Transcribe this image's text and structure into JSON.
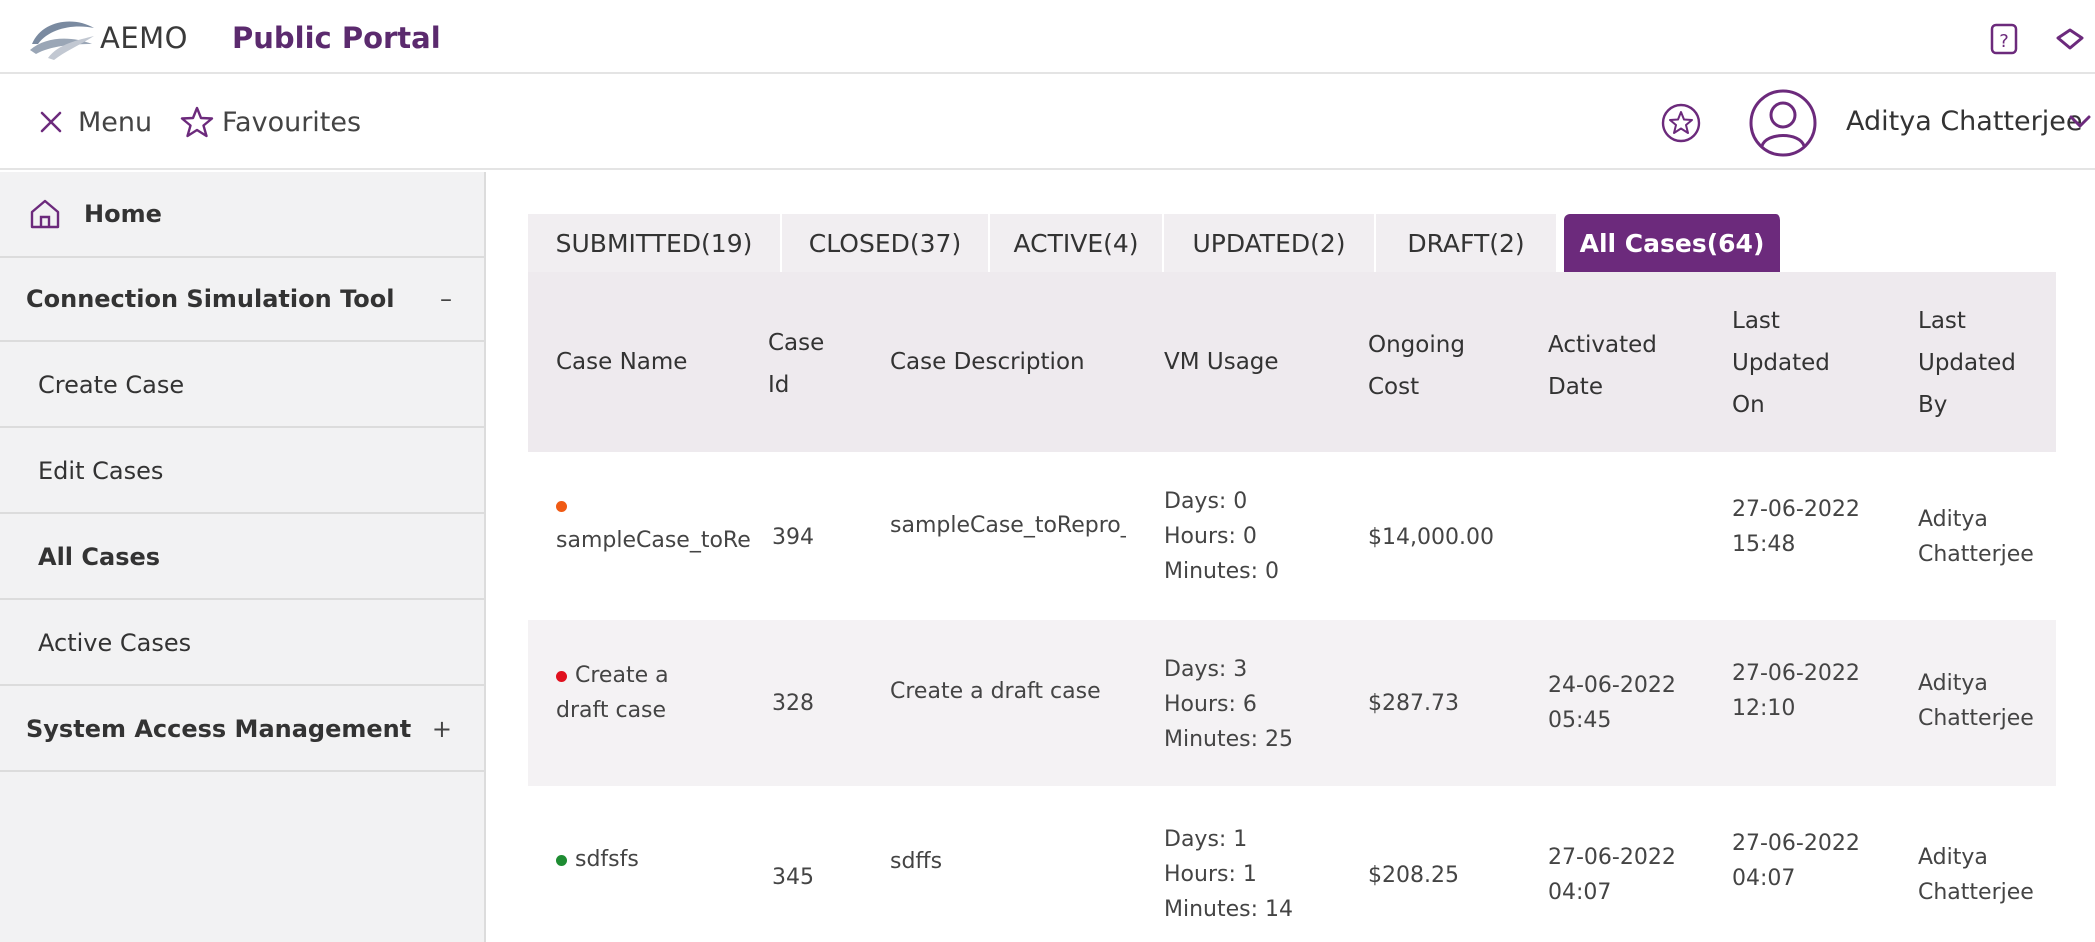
{
  "header": {
    "brand": "AEMO",
    "portal_name": "Public Portal"
  },
  "navbar": {
    "menu_label": "Menu",
    "favourites_label": "Favourites",
    "user_name": "Aditya Chatterjee"
  },
  "sidebar": {
    "home": "Home",
    "items": [
      {
        "label": "Connection Simulation Tool",
        "sign": "–"
      },
      {
        "label": "Create Case"
      },
      {
        "label": "Edit Cases"
      },
      {
        "label": "All Cases"
      },
      {
        "label": "Active Cases"
      },
      {
        "label": "System Access Management",
        "sign": "+"
      }
    ]
  },
  "tabs": [
    {
      "label": "SUBMITTED(19)"
    },
    {
      "label": "CLOSED(37)"
    },
    {
      "label": "ACTIVE(4)"
    },
    {
      "label": "UPDATED(2)"
    },
    {
      "label": "DRAFT(2)"
    },
    {
      "label": "All Cases(64)"
    }
  ],
  "table": {
    "headers": {
      "case_name": "Case Name",
      "case_id_1": "Case",
      "case_id_2": "Id",
      "case_description": "Case Description",
      "vm_usage": "VM Usage",
      "ongoing_cost_1": "Ongoing",
      "ongoing_cost_2": "Cost",
      "activated_date_1": "Activated",
      "activated_date_2": "Date",
      "last_updated_on_1": "Last",
      "last_updated_on_2": "Updated",
      "last_updated_on_3": "On",
      "last_updated_by_1": "Last",
      "last_updated_by_2": "Updated",
      "last_updated_by_3": "By"
    },
    "rows": [
      {
        "status_color": "#f05a14",
        "name_line1": "",
        "name_line2": "sampleCase_toRe",
        "case_id": "394",
        "description": "sampleCase_toRepro_Is",
        "days": "Days: 0",
        "hours": "Hours: 0",
        "minutes": "Minutes: 0",
        "cost": "$14,000.00",
        "activated_date": "",
        "activated_time": "",
        "updated_date": "27-06-2022",
        "updated_time": "15:48",
        "updated_by_1": "Aditya",
        "updated_by_2": "Chatterjee"
      },
      {
        "status_color": "#e0101e",
        "name_line1": "Create a",
        "name_line2": "draft case",
        "case_id": "328",
        "description": "Create a draft case",
        "days": "Days: 3",
        "hours": "Hours: 6",
        "minutes": "Minutes: 25",
        "cost": "$287.73",
        "activated_date": "24-06-2022",
        "activated_time": "05:45",
        "updated_date": "27-06-2022",
        "updated_time": "12:10",
        "updated_by_1": "Aditya",
        "updated_by_2": "Chatterjee"
      },
      {
        "status_color": "#1e8c32",
        "name_line1": "sdfsfs",
        "name_line2": "",
        "case_id": "345",
        "description": "sdffs",
        "days": "Days: 1",
        "hours": "Hours: 1",
        "minutes": "Minutes: 14",
        "cost": "$208.25",
        "activated_date": "27-06-2022",
        "activated_time": "04:07",
        "updated_date": "27-06-2022",
        "updated_time": "04:07",
        "updated_by_1": "Aditya",
        "updated_by_2": "Chatterjee"
      }
    ]
  },
  "colors": {
    "accent": "#6c2a7c",
    "portal_title": "#5b2a6e"
  },
  "icons": [
    "aemo-logo-icon",
    "help-icon",
    "bell-icon",
    "close-icon",
    "star-icon",
    "star-circle-icon",
    "user-avatar-icon",
    "chevron-down-icon",
    "home-icon"
  ]
}
